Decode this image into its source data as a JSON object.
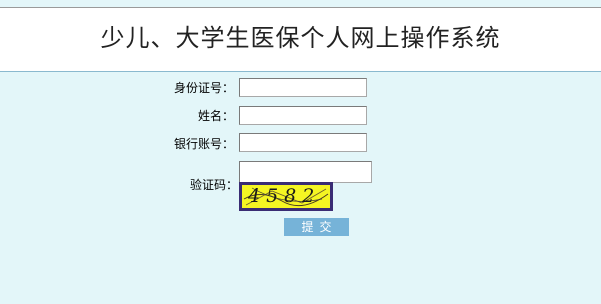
{
  "header": {
    "title": "少儿、大学生医保个人网上操作系统"
  },
  "form": {
    "id_number_label": "身份证号：",
    "id_number_value": "",
    "name_label": "姓名：",
    "name_value": "",
    "bank_account_label": "银行账号：",
    "bank_account_value": "",
    "captcha_label": "验证码：",
    "captcha_value": "",
    "captcha_image_text": "4582",
    "submit_label": "提交"
  },
  "colors": {
    "page_background": "#e3f6f9",
    "header_background": "#ffffff",
    "submit_button": "#76b3d8",
    "captcha_background": "#f5f523",
    "captcha_border": "#3a2c74"
  }
}
